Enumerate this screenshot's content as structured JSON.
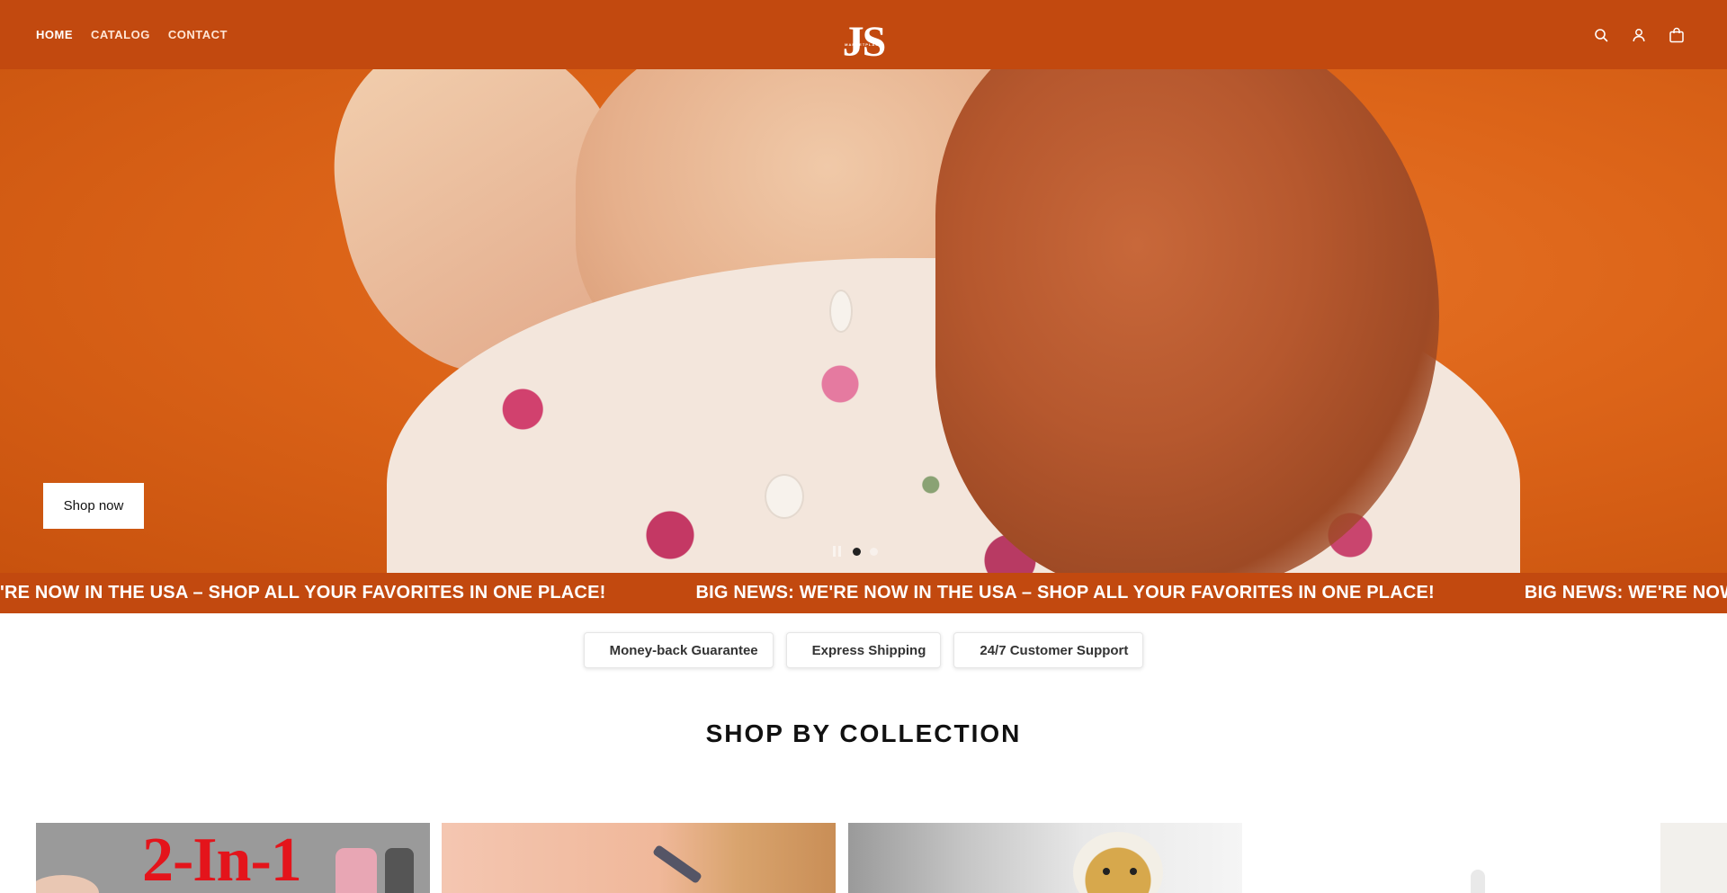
{
  "header": {
    "nav": [
      "HOME",
      "CATALOG",
      "CONTACT"
    ],
    "active_nav": "HOME",
    "logo_text": "JS",
    "logo_subtext": "MARKETPLACE",
    "brand_color": "#c2490f",
    "icons": [
      "search-icon",
      "account-icon",
      "cart-icon"
    ]
  },
  "hero": {
    "cta_label": "Shop now",
    "slide_count": 2,
    "active_slide": 1
  },
  "announcement": {
    "text": "BIG NEWS: WE'RE NOW IN THE USA – SHOP ALL YOUR FAVORITES IN ONE PLACE!",
    "partial_start": "'RE NOW IN THE USA – SHOP ALL YOUR FAVORITES IN ONE PLACE!",
    "partial_end": "BIG NEWS: WE'RE NOW IN THE"
  },
  "badges": [
    "Money-back Guarantee",
    "Express Shipping",
    "24/7 Customer Support"
  ],
  "collections": {
    "title": "SHOP BY COLLECTION",
    "card1_headline": "2-In-1"
  }
}
